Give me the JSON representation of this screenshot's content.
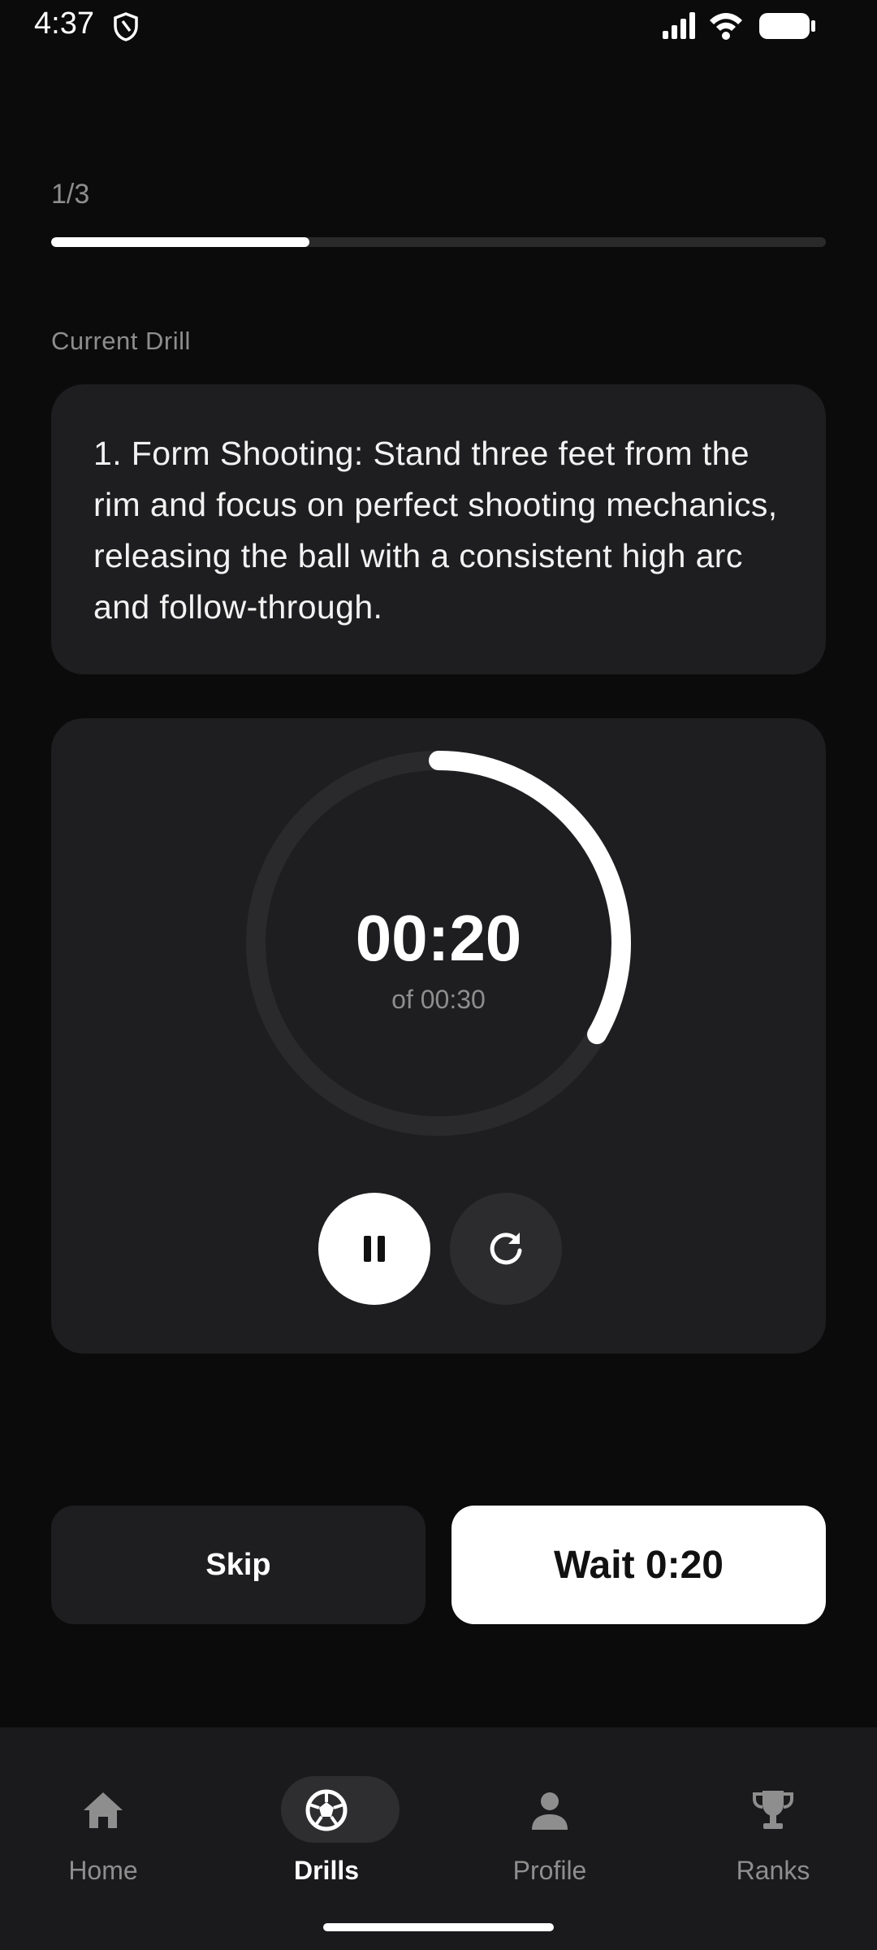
{
  "status_bar": {
    "time": "4:37"
  },
  "progress": {
    "counter": "1/3",
    "fraction": 0.333
  },
  "drill": {
    "section_label": "Current Drill",
    "description": "1. Form Shooting: Stand three feet from the rim and focus on perfect shooting mechanics, releasing the ball with a consistent high arc and follow-through."
  },
  "timer": {
    "elapsed_display": "00:20",
    "total_display": "of 00:30",
    "remaining_fraction": 0.333
  },
  "actions": {
    "skip_label": "Skip",
    "wait_label": "Wait 0:20"
  },
  "bottom_nav": {
    "items": [
      {
        "label": "Home",
        "icon": "home-icon",
        "active": false
      },
      {
        "label": "Drills",
        "icon": "soccer-ball-icon",
        "active": true
      },
      {
        "label": "Profile",
        "icon": "person-icon",
        "active": false
      },
      {
        "label": "Ranks",
        "icon": "trophy-icon",
        "active": false
      }
    ]
  },
  "colors": {
    "background": "#0b0b0b",
    "card": "#1e1e20",
    "accent": "#ffffff",
    "muted_text": "#8e8e8e"
  }
}
